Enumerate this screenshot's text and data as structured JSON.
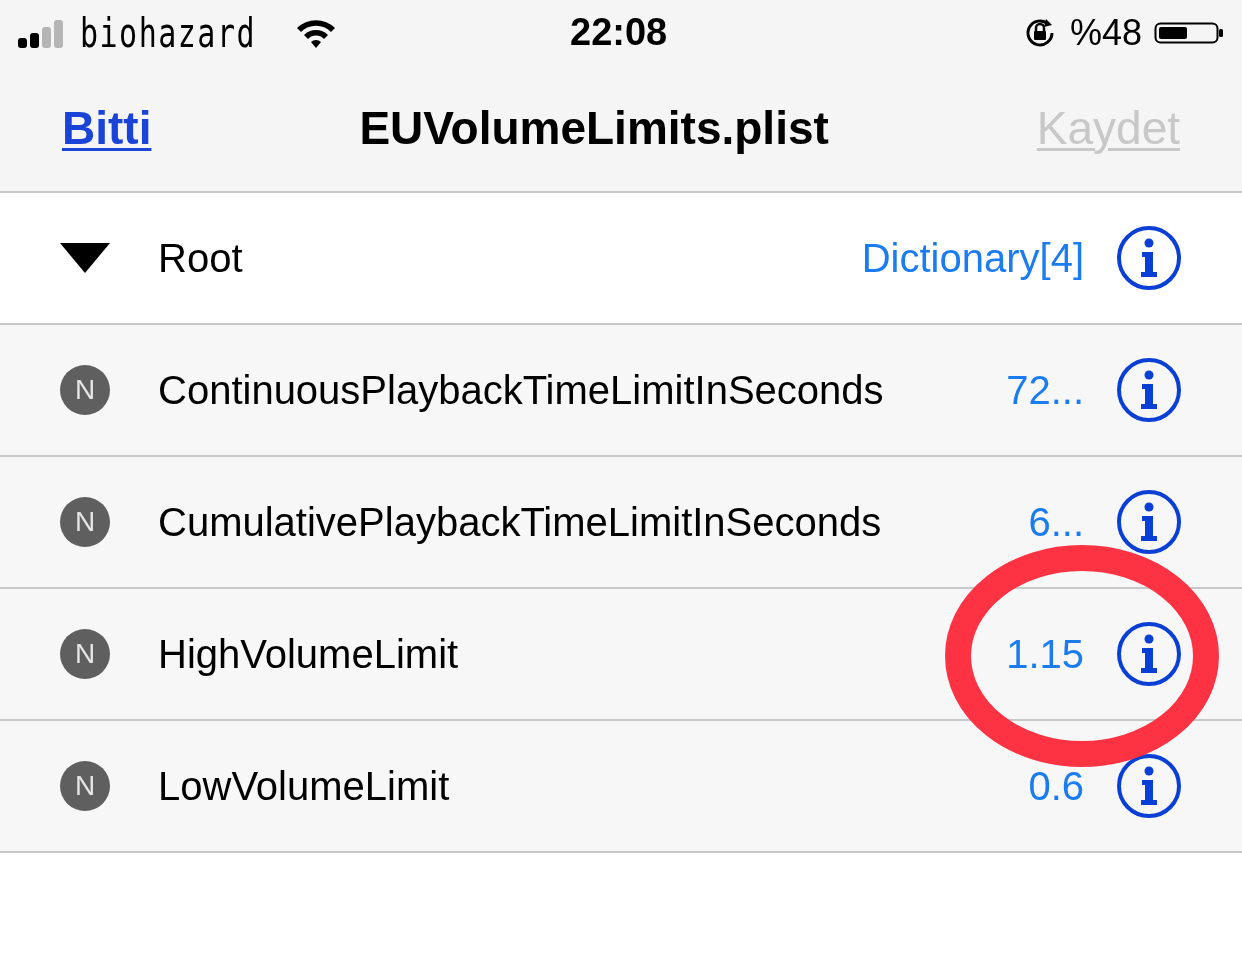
{
  "status_bar": {
    "carrier": "biohazard",
    "time": "22:08",
    "battery": "%48"
  },
  "nav_bar": {
    "left_button": {
      "label": "Bitti",
      "disabled": false
    },
    "title": "EUVolumeLimits.plist",
    "right_button": {
      "label": "Kaydet",
      "disabled": true
    }
  },
  "rows": [
    {
      "kind": "root",
      "key": "Root",
      "value": "Dictionary[4]",
      "expanded": true
    },
    {
      "kind": "number",
      "badge": "N",
      "key": "ContinuousPlaybackTimeLimitInSeconds",
      "value": "72..."
    },
    {
      "kind": "number",
      "badge": "N",
      "key": "CumulativePlaybackTimeLimitInSeconds",
      "value": "6..."
    },
    {
      "kind": "number",
      "badge": "N",
      "key": "HighVolumeLimit",
      "value": "1.15"
    },
    {
      "kind": "number",
      "badge": "N",
      "key": "LowVolumeLimit",
      "value": "0.6"
    }
  ]
}
